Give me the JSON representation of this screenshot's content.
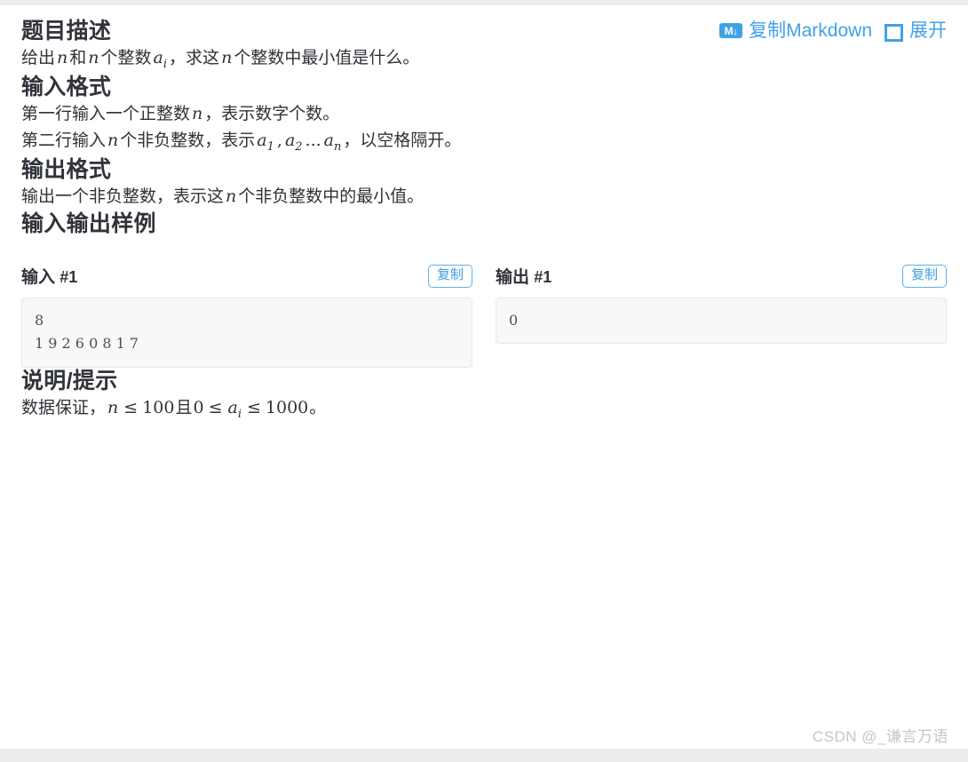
{
  "sections": {
    "description": {
      "title": "题目描述",
      "paragraph": {
        "p1": "给出",
        "v1": "n",
        "p2": "和",
        "v2": "n",
        "p3": "个整数",
        "v3": "a",
        "v3sub": "i",
        "p4": "，求这",
        "v4": "n",
        "p5": "个整数中最小值是什么。"
      }
    },
    "input_format": {
      "title": "输入格式",
      "line1": {
        "p1": "第一行输入一个正整数",
        "v1": "n",
        "p2": "，表示数字个数。"
      },
      "line2": {
        "p1": "第二行输入",
        "v1": "n",
        "p2": "个非负整数，表示",
        "v2": "a",
        "v2sub": "1",
        "sep1": ",",
        "v3": "a",
        "v3sub": "2",
        "dots": "...",
        "v4": "a",
        "v4sub": "n",
        "p3": "，以空格隔开。"
      }
    },
    "output_format": {
      "title": "输出格式",
      "line1": {
        "p1": "输出一个非负整数，表示这",
        "v1": "n",
        "p2": "个非负整数中的最小值。"
      }
    },
    "samples": {
      "title": "输入输出样例",
      "items": [
        {
          "label": "输入",
          "index": "#1",
          "copy_label": "复制",
          "content": "8\n1 9 2 6 0 8 1 7"
        },
        {
          "label": "输出",
          "index": "#1",
          "copy_label": "复制",
          "content": "0"
        }
      ]
    },
    "notes": {
      "title": "说明/提示",
      "line1": {
        "p1": "数据保证，",
        "v1": "n",
        "op1": "≤",
        "n1": "100",
        "p2": "且",
        "n2": "0",
        "op2": "≤",
        "v2": "a",
        "v2sub": "i",
        "op3": "≤",
        "n3": "1000",
        "p3": "。"
      }
    }
  },
  "header_actions": {
    "copy_markdown": {
      "icon_text": "M↓",
      "label": "复制Markdown"
    },
    "expand": {
      "label": "展开"
    }
  },
  "watermark": "CSDN @_谦言万语",
  "colors": {
    "accent": "#41a1e6",
    "heading": "#30333a",
    "text": "#2f3237",
    "code_bg": "#f8f8f8"
  }
}
